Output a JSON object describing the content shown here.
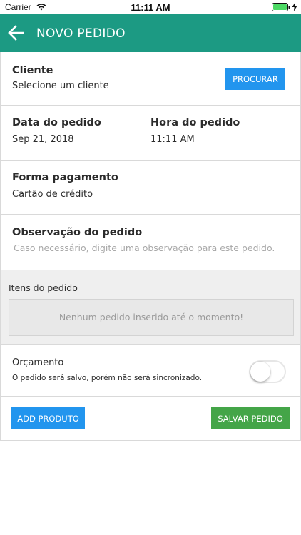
{
  "status_bar": {
    "carrier": "Carrier",
    "time": "11:11 AM",
    "icons": [
      "wifi-icon",
      "battery-icon",
      "charging-icon"
    ]
  },
  "app_bar": {
    "title": "NOVO PEDIDO",
    "back_icon": "arrow-left-icon",
    "color": "#1c9a83"
  },
  "cliente": {
    "label": "Cliente",
    "value": "Selecione um cliente",
    "button": "PROCURAR"
  },
  "data_pedido": {
    "label": "Data do pedido",
    "value": "Sep 21, 2018"
  },
  "hora_pedido": {
    "label": "Hora do pedido",
    "value": "11:11 AM"
  },
  "forma_pagamento": {
    "label": "Forma pagamento",
    "value": "Cartão de crédito"
  },
  "observacao": {
    "label": "Observação do pedido",
    "placeholder": "Caso necessário, digite uma observação para este pedido."
  },
  "itens": {
    "title": "Itens do pedido",
    "empty_message": "Nenhum pedido inserido até o momento!"
  },
  "orcamento": {
    "label": "Orçamento",
    "description": "O pedido será salvo, porém não será sincronizado.",
    "enabled": false
  },
  "actions": {
    "add_label": "ADD PRODUTO",
    "save_label": "SALVAR PEDIDO",
    "blue": "#2295ee",
    "green": "#44a548"
  }
}
